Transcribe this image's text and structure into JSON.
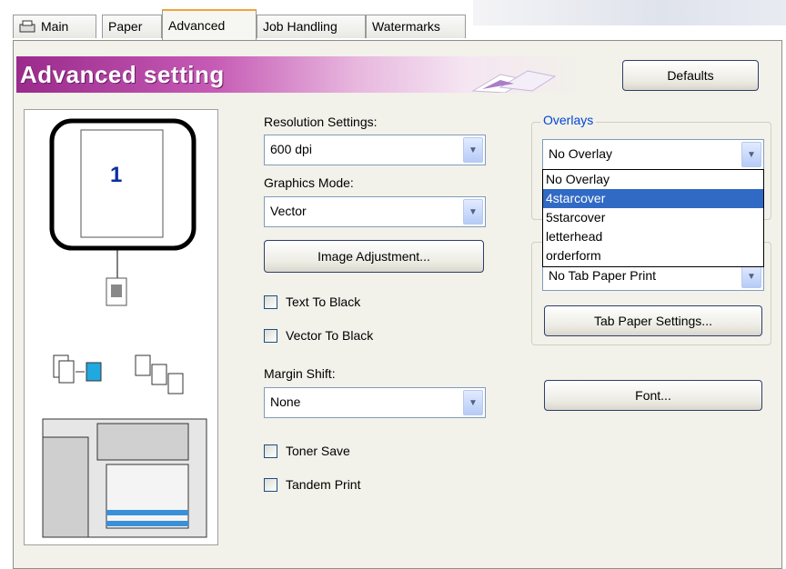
{
  "tabs": [
    {
      "label": "Main"
    },
    {
      "label": "Paper"
    },
    {
      "label": "Advanced"
    },
    {
      "label": "Job Handling"
    },
    {
      "label": "Watermarks"
    }
  ],
  "banner": {
    "title": "Advanced setting"
  },
  "buttons": {
    "defaults": "Defaults",
    "image_adjustment": "Image Adjustment...",
    "tab_paper_settings": "Tab Paper Settings...",
    "font": "Font..."
  },
  "preview": {
    "page_number": "1"
  },
  "resolution": {
    "label": "Resolution Settings:",
    "value": "600 dpi"
  },
  "graphics_mode": {
    "label": "Graphics Mode:",
    "value": "Vector"
  },
  "checkboxes": {
    "text_to_black": "Text To Black",
    "vector_to_black": "Vector To Black",
    "toner_save": "Toner Save",
    "tandem_print": "Tandem Print"
  },
  "margin_shift": {
    "label": "Margin Shift:",
    "value": "None"
  },
  "overlays": {
    "group_title": "Overlays",
    "value": "No Overlay",
    "options": [
      "No Overlay",
      "4starcover",
      "5starcover",
      "letterhead",
      "orderform"
    ],
    "highlighted_index": 1
  },
  "tab_paper": {
    "value": "No Tab Paper Print"
  },
  "colors": {
    "banner": "#9a2a8c",
    "selection": "#316ac5",
    "group_title": "#0046d5"
  }
}
